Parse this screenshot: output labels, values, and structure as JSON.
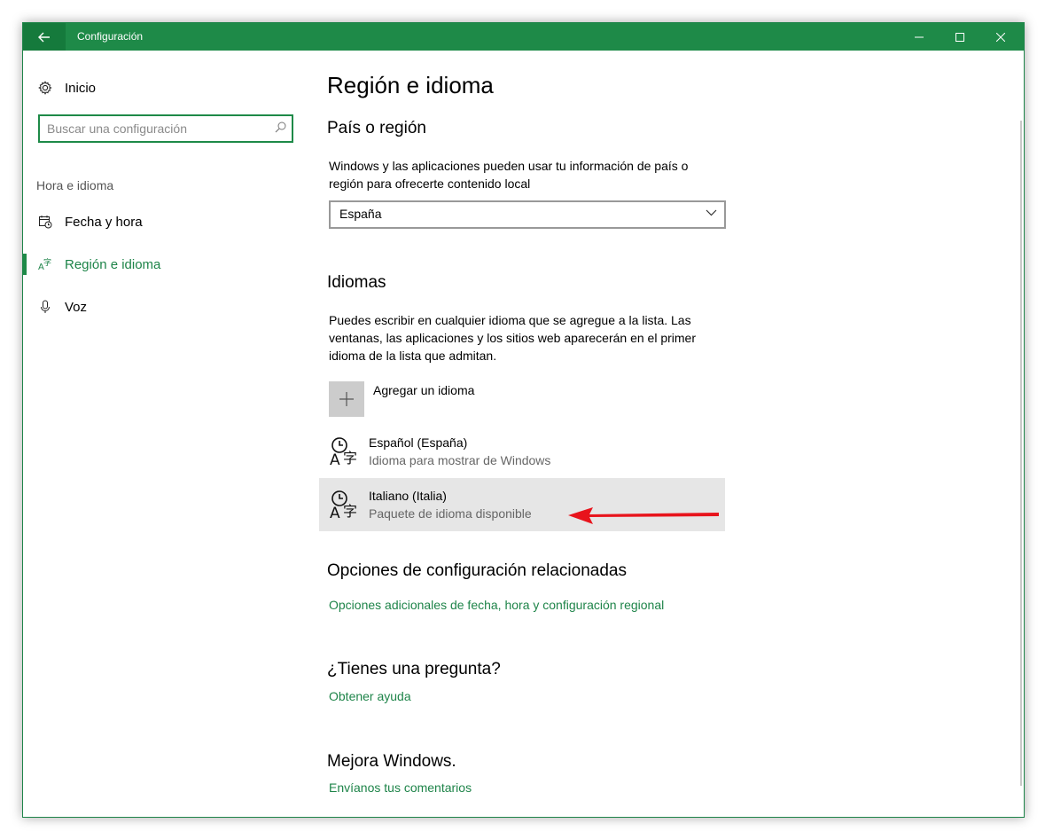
{
  "window": {
    "title": "Configuración",
    "accent_color": "#1e8a48",
    "controls": [
      "minimize-icon",
      "maximize-icon",
      "close-icon"
    ]
  },
  "sidebar": {
    "home_label": "Inicio",
    "search": {
      "placeholder": "Buscar una configuración",
      "value": ""
    },
    "section_label": "Hora e idioma",
    "items": [
      {
        "label": "Fecha y hora",
        "icon": "calendar-clock-icon",
        "active": false
      },
      {
        "label": "Región e idioma",
        "icon": "region-language-icon",
        "active": true
      },
      {
        "label": "Voz",
        "icon": "microphone-icon",
        "active": false
      }
    ]
  },
  "main": {
    "title": "Región e idioma",
    "country": {
      "heading": "País o región",
      "description": "Windows y las aplicaciones pueden usar tu información de país o región para ofrecerte contenido local",
      "selected": "España"
    },
    "languages": {
      "heading": "Idiomas",
      "description": "Puedes escribir en cualquier idioma que se agregue a la lista. Las ventanas, las aplicaciones y los sitios web aparecerán en el primer idioma de la lista que admitan.",
      "add_label": "Agregar un idioma",
      "items": [
        {
          "name": "Español (España)",
          "status": "Idioma para mostrar de Windows"
        },
        {
          "name": "Italiano (Italia)",
          "status": "Paquete de idioma disponible"
        }
      ]
    },
    "related": {
      "heading": "Opciones de configuración relacionadas",
      "link": "Opciones adicionales de fecha, hora y configuración regional"
    },
    "question": {
      "heading": "¿Tienes una pregunta?",
      "link": "Obtener ayuda"
    },
    "improve": {
      "heading": "Mejora Windows.",
      "link": "Envíanos tus comentarios"
    }
  },
  "annotation": {
    "arrow_color": "#e8141c"
  }
}
